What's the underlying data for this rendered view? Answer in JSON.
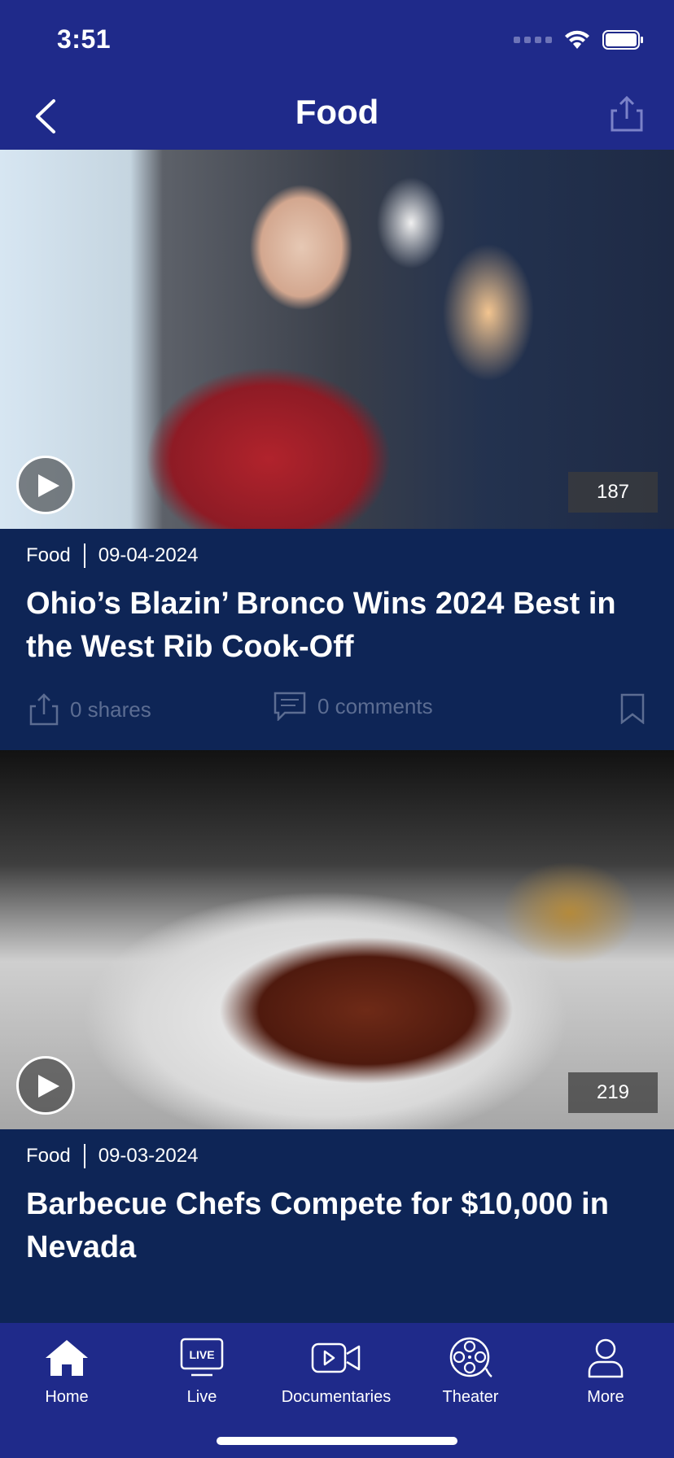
{
  "status_bar": {
    "time": "3:51"
  },
  "header": {
    "title": "Food"
  },
  "articles": [
    {
      "views": "187",
      "category": "Food",
      "date": "09-04-2024",
      "title": "Ohio’s Blazin’ Bronco Wins 2024 Best in the West Rib Cook-Off",
      "shares": "0 shares",
      "comments": "0 comments"
    },
    {
      "views": "219",
      "category": "Food",
      "date": "09-03-2024",
      "title": "Barbecue Chefs Compete for $10,000 in Nevada"
    }
  ],
  "tabs": [
    {
      "label": "Home",
      "icon": "home-icon"
    },
    {
      "label": "Live",
      "icon": "live-tv-icon",
      "badge": "LIVE"
    },
    {
      "label": "Documentaries",
      "icon": "video-camera-icon"
    },
    {
      "label": "Theater",
      "icon": "film-reel-icon"
    },
    {
      "label": "More",
      "icon": "person-icon"
    }
  ],
  "colors": {
    "nav": "#1f2a8a",
    "content_bg": "#0e2556",
    "muted": "#5c6d92"
  }
}
